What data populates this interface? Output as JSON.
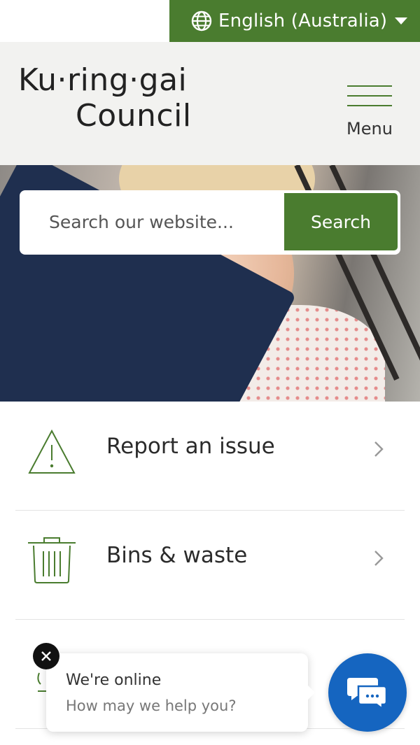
{
  "language_bar": {
    "label": "English (Australia)",
    "icon": "globe-icon"
  },
  "header": {
    "logo_line1": "Ku·ring·gai",
    "logo_line2": "Council",
    "menu_label": "Menu"
  },
  "search": {
    "placeholder": "Search our website...",
    "value": "",
    "button_label": "Search"
  },
  "quick_links": [
    {
      "label": "Report an issue",
      "icon": "warning-triangle-icon"
    },
    {
      "label": "Bins & waste",
      "icon": "trash-bin-icon"
    }
  ],
  "chat": {
    "status": "We're online",
    "prompt": "How may we help you?"
  },
  "colors": {
    "accent_green": "#4a7c2f",
    "header_bg": "#f2f2f0",
    "chat_blue": "#1565c0"
  }
}
